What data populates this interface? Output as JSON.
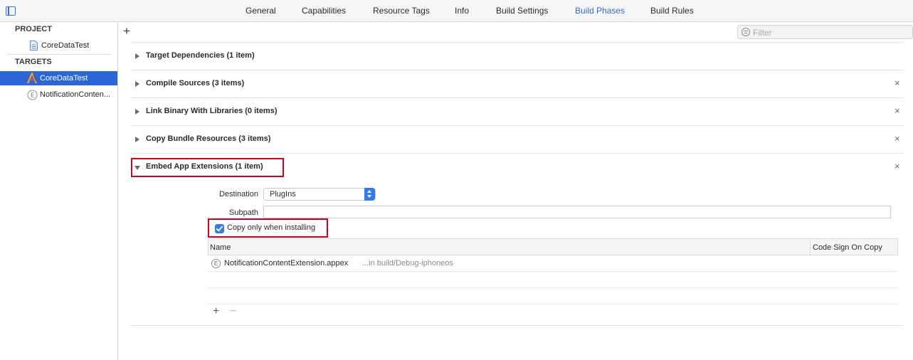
{
  "tabs": [
    "General",
    "Capabilities",
    "Resource Tags",
    "Info",
    "Build Settings",
    "Build Phases",
    "Build Rules"
  ],
  "active_tab": "Build Phases",
  "sidebar": {
    "project_header": "PROJECT",
    "project_item": "CoreDataTest",
    "targets_header": "TARGETS",
    "targets": [
      "CoreDataTest",
      "NotificationConten..."
    ],
    "selected_target": "CoreDataTest"
  },
  "toolbar": {
    "add_symbol": "+",
    "filter_placeholder": "Filter"
  },
  "phases": [
    {
      "title": "Target Dependencies (1 item)",
      "expanded": false,
      "removable": false
    },
    {
      "title": "Compile Sources (3 items)",
      "expanded": false,
      "removable": true
    },
    {
      "title": "Link Binary With Libraries (0 items)",
      "expanded": false,
      "removable": true
    },
    {
      "title": "Copy Bundle Resources (3 items)",
      "expanded": false,
      "removable": true
    },
    {
      "title": "Embed App Extensions (1 item)",
      "expanded": true,
      "removable": true
    }
  ],
  "close_symbol": "×",
  "embed": {
    "destination_label": "Destination",
    "destination_value": "PlugIns",
    "subpath_label": "Subpath",
    "subpath_value": "",
    "copy_only_label": "Copy only when installing",
    "copy_only_checked": true,
    "columns": [
      "Name",
      "Code Sign On Copy"
    ],
    "rows": [
      {
        "icon": "E",
        "name": "NotificationContentExtension.appex",
        "path": "...in build/Debug-iphoneos"
      }
    ],
    "add_symbol": "+",
    "remove_symbol": "−"
  },
  "colors": {
    "accent": "#2b66d9",
    "highlight_box": "#d0021b",
    "active_tab": "#2d6fd6"
  }
}
